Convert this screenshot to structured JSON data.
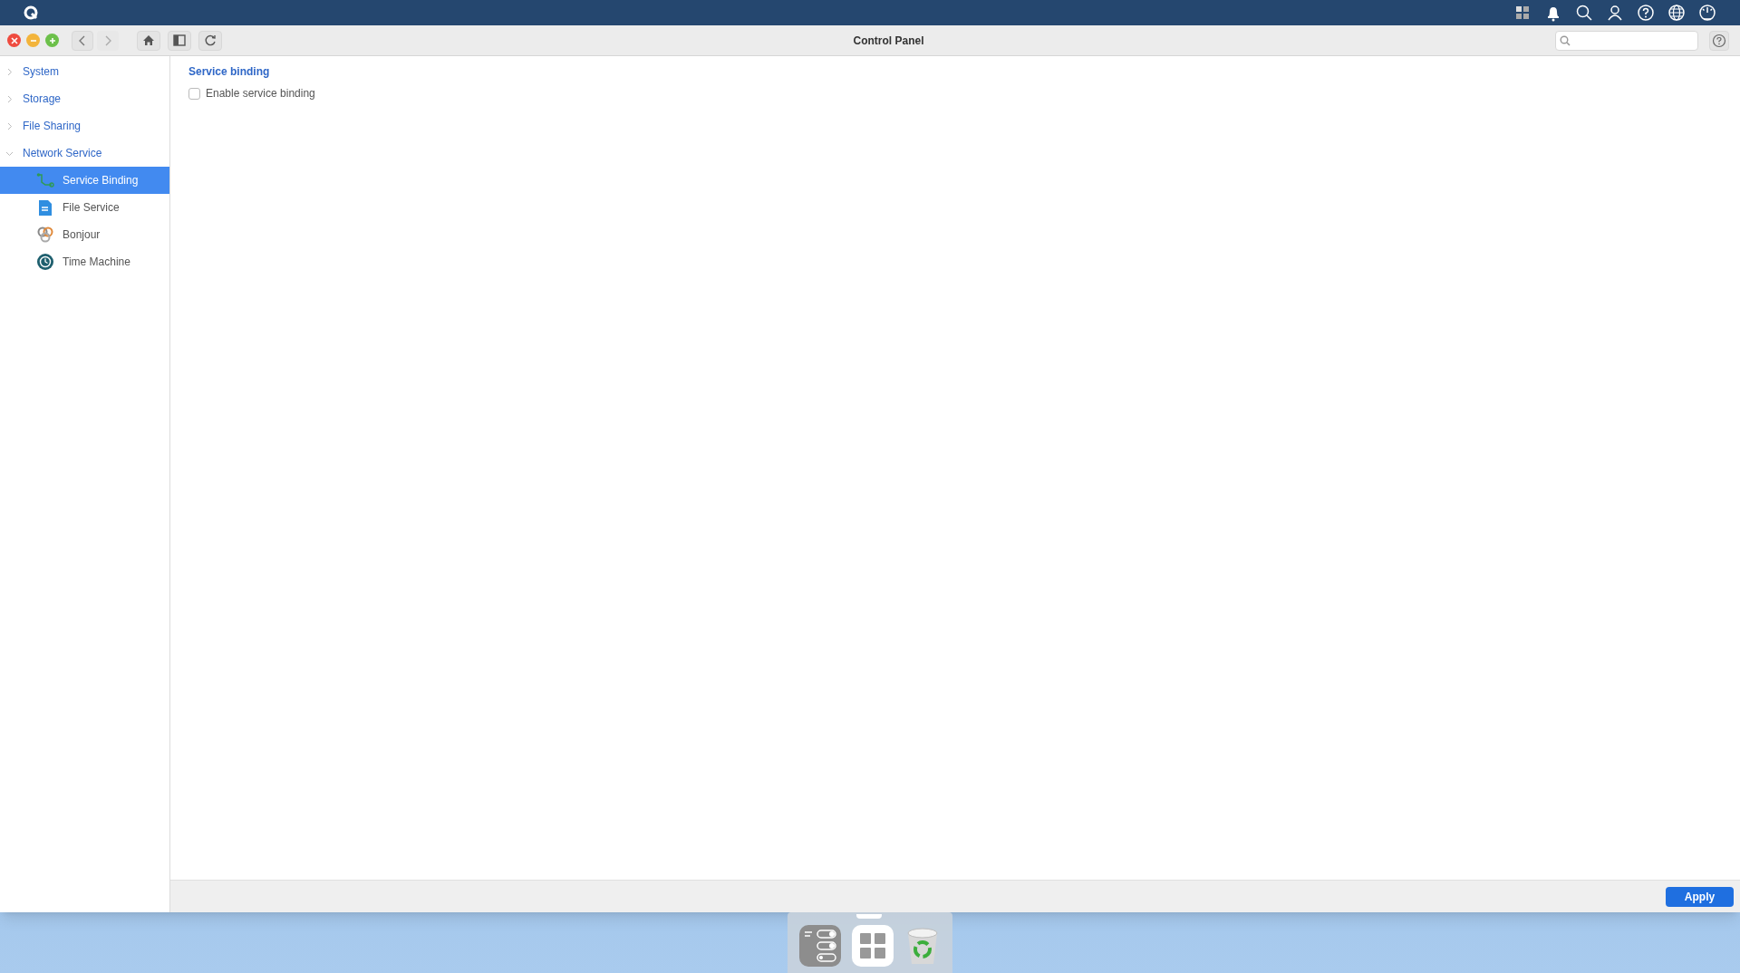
{
  "window": {
    "title": "Control Panel"
  },
  "sidebar": {
    "items": [
      {
        "label": "System",
        "expanded": false
      },
      {
        "label": "Storage",
        "expanded": false
      },
      {
        "label": "File Sharing",
        "expanded": false
      },
      {
        "label": "Network Service",
        "expanded": true,
        "children": [
          {
            "label": "Service Binding",
            "kind": "binding",
            "selected": true
          },
          {
            "label": "File Service",
            "kind": "file",
            "selected": false
          },
          {
            "label": "Bonjour",
            "kind": "bonjour",
            "selected": false
          },
          {
            "label": "Time Machine",
            "kind": "timemachine",
            "selected": false
          }
        ]
      }
    ]
  },
  "content": {
    "title": "Service binding",
    "options": [
      {
        "label": "Enable service binding",
        "checked": false
      }
    ]
  },
  "footer": {
    "apply_button": "Apply"
  }
}
